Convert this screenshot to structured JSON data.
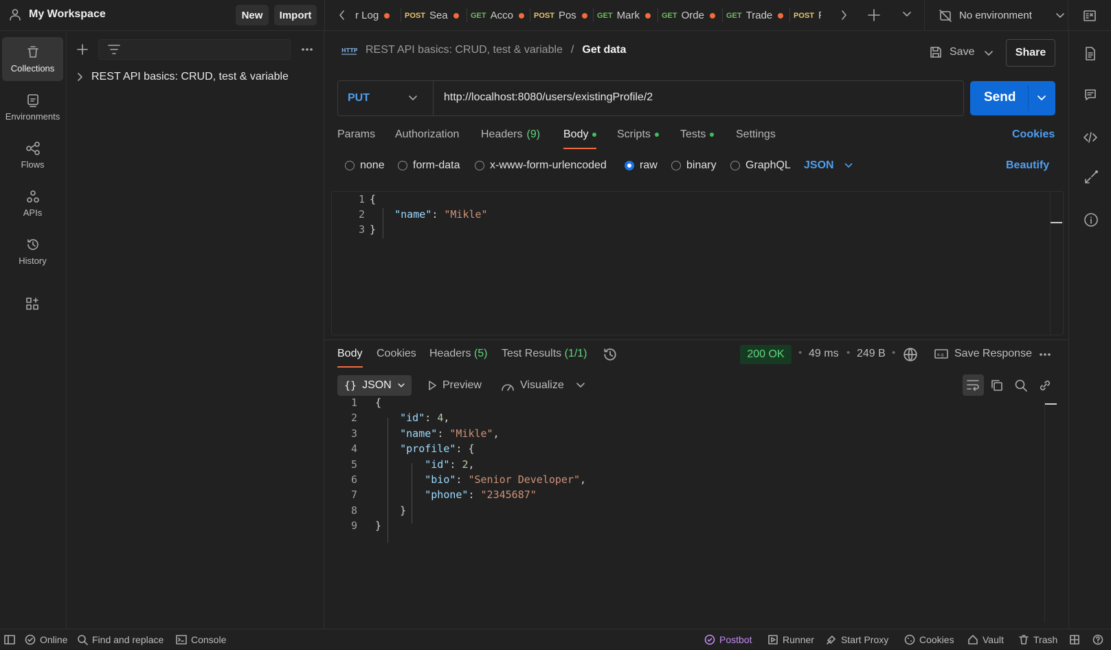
{
  "workspace": {
    "name": "My Workspace",
    "new_label": "New",
    "import_label": "Import"
  },
  "tabs": [
    {
      "method": "",
      "name": "r Log"
    },
    {
      "method": "POST",
      "name": "Sea"
    },
    {
      "method": "GET",
      "name": "Acco"
    },
    {
      "method": "POST",
      "name": "Pos"
    },
    {
      "method": "GET",
      "name": "Mark"
    },
    {
      "method": "GET",
      "name": "Orde"
    },
    {
      "method": "GET",
      "name": "Trade"
    },
    {
      "method": "POST",
      "name": "F"
    }
  ],
  "environment": {
    "label": "No environment"
  },
  "rail": [
    {
      "label": "Collections",
      "icon": "trash-bin-icon"
    },
    {
      "label": "Environments",
      "icon": "environment-icon"
    },
    {
      "label": "Flows",
      "icon": "flows-icon"
    },
    {
      "label": "APIs",
      "icon": "apis-icon"
    },
    {
      "label": "History",
      "icon": "history-icon"
    }
  ],
  "sidebar": {
    "collection": "REST API basics: CRUD, test & variable"
  },
  "request": {
    "breadcrumb_parent": "REST API basics: CRUD, test & variable",
    "breadcrumb_sep": "/",
    "title": "Get data",
    "save_label": "Save",
    "share_label": "Share",
    "method": "PUT",
    "url": "http://localhost:8080/users/existingProfile/2",
    "send_label": "Send",
    "tabs": {
      "params": "Params",
      "authorization": "Authorization",
      "headers": "Headers",
      "headers_count": "(9)",
      "body": "Body",
      "scripts": "Scripts",
      "tests": "Tests",
      "settings": "Settings",
      "cookies": "Cookies"
    },
    "body_types": {
      "none": "none",
      "form_data": "form-data",
      "urlencoded": "x-www-form-urlencoded",
      "raw": "raw",
      "binary": "binary",
      "graphql": "GraphQL",
      "format": "JSON",
      "beautify": "Beautify"
    },
    "body_lines": [
      {
        "num": "1",
        "indent": "",
        "key": "",
        "sep": "",
        "val": "",
        "val_type": "",
        "tail": "{"
      },
      {
        "num": "2",
        "indent": "    ",
        "key": "\"name\"",
        "sep": ": ",
        "val": "\"Mikle\"",
        "val_type": "s",
        "tail": ""
      },
      {
        "num": "3",
        "indent": "",
        "key": "",
        "sep": "",
        "val": "",
        "val_type": "",
        "tail": "}"
      }
    ]
  },
  "response": {
    "tabs": {
      "body": "Body",
      "cookies": "Cookies",
      "headers": "Headers",
      "headers_count": "(5)",
      "test_results": "Test Results",
      "test_count": "(1/1)"
    },
    "status": "200 OK",
    "time": "49 ms",
    "size": "249 B",
    "save_response": "Save Response",
    "format": "JSON",
    "preview": "Preview",
    "visualize": "Visualize",
    "lines": [
      {
        "num": "1",
        "indent": "",
        "key": "",
        "sep": "",
        "val": "",
        "val_type": "",
        "tail": "{"
      },
      {
        "num": "2",
        "indent": "    ",
        "key": "\"id\"",
        "sep": ": ",
        "val": "4",
        "val_type": "n",
        "tail": ","
      },
      {
        "num": "3",
        "indent": "    ",
        "key": "\"name\"",
        "sep": ": ",
        "val": "\"Mikle\"",
        "val_type": "s",
        "tail": ","
      },
      {
        "num": "4",
        "indent": "    ",
        "key": "\"profile\"",
        "sep": ": ",
        "val": "",
        "val_type": "",
        "tail": "{"
      },
      {
        "num": "5",
        "indent": "        ",
        "key": "\"id\"",
        "sep": ": ",
        "val": "2",
        "val_type": "n",
        "tail": ","
      },
      {
        "num": "6",
        "indent": "        ",
        "key": "\"bio\"",
        "sep": ": ",
        "val": "\"Senior Developer\"",
        "val_type": "s",
        "tail": ","
      },
      {
        "num": "7",
        "indent": "        ",
        "key": "\"phone\"",
        "sep": ": ",
        "val": "\"2345687\"",
        "val_type": "s",
        "tail": ""
      },
      {
        "num": "8",
        "indent": "    ",
        "key": "",
        "sep": "",
        "val": "",
        "val_type": "",
        "tail": "}"
      },
      {
        "num": "9",
        "indent": "",
        "key": "",
        "sep": "",
        "val": "",
        "val_type": "",
        "tail": "}"
      }
    ]
  },
  "statusbar": {
    "online": "Online",
    "find_replace": "Find and replace",
    "console": "Console",
    "postbot": "Postbot",
    "runner": "Runner",
    "start_proxy": "Start Proxy",
    "cookies": "Cookies",
    "vault": "Vault",
    "trash": "Trash"
  },
  "colors": {
    "accent": "#0f6ad8",
    "link": "#4f9ff0",
    "status_ok": "#5fd67d",
    "dirty_dot": "#f26b3a",
    "postbot": "#c38bf5"
  }
}
